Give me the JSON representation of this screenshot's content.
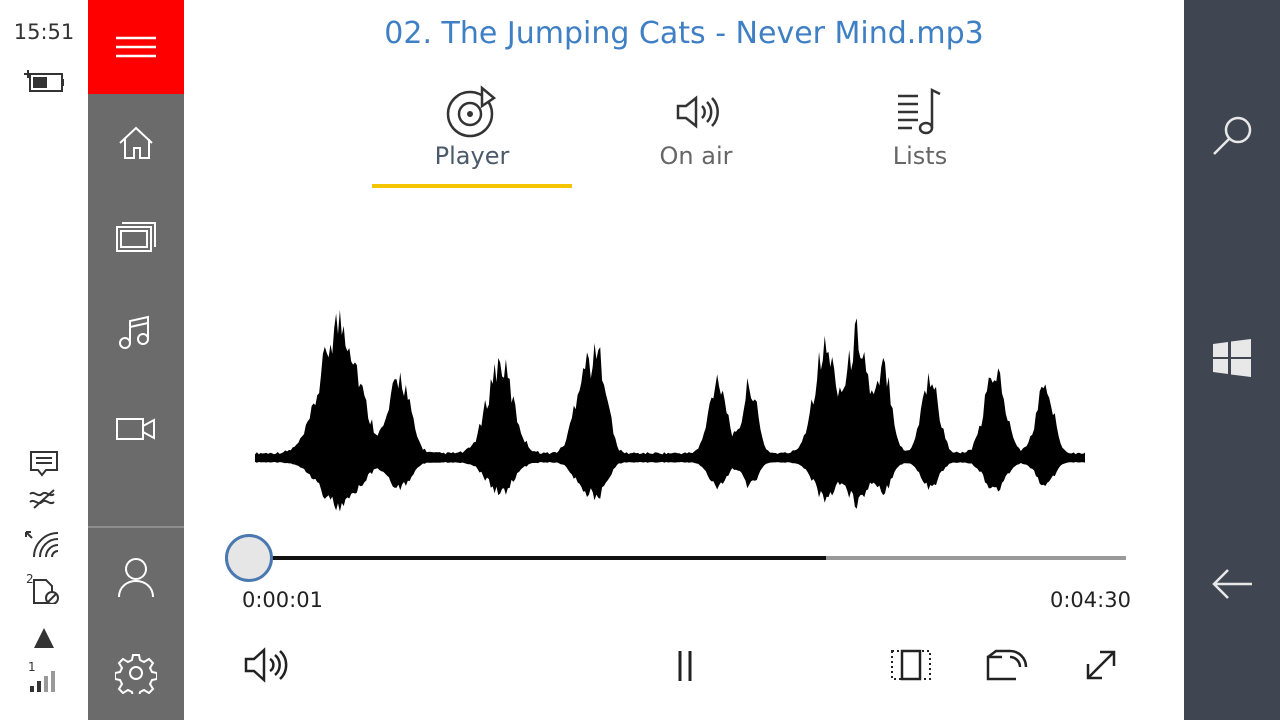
{
  "status_bar": {
    "time": "15:51",
    "signal_sim_1": "1",
    "sim_2_label": "2",
    "icons": [
      "battery-charging-icon",
      "message-icon",
      "quiet-hours-icon",
      "wifi-icon",
      "sim-blocked-icon",
      "data-arrow-icon",
      "signal-bars-icon"
    ]
  },
  "left_nav": {
    "accent_color": "#ff0000",
    "items": [
      "hamburger-menu",
      "home",
      "gallery",
      "music",
      "video",
      "account",
      "settings"
    ]
  },
  "title": "02. The Jumping Cats - Never Mind.mp3",
  "tabs": [
    {
      "label": "Player",
      "icon": "player-disc-icon",
      "active": true
    },
    {
      "label": "On air",
      "icon": "speaker-icon",
      "active": false
    },
    {
      "label": "Lists",
      "icon": "playlist-icon",
      "active": false
    }
  ],
  "colors": {
    "title": "#3f7fc4",
    "active_tab": "#4a5a6a",
    "inactive_tab": "#666666",
    "tab_underline": "#f5c400",
    "right_bar": "#3f4652"
  },
  "playback": {
    "elapsed": "0:00:01",
    "duration": "0:04:30",
    "played_fraction": 0.0037,
    "buffered_fraction": 0.66
  },
  "controls": [
    "volume-icon",
    "pause-icon",
    "aspect-ratio-icon",
    "cast-icon",
    "fullscreen-icon"
  ],
  "right_bar": [
    "search-icon",
    "windows-start-icon",
    "back-arrow-icon"
  ]
}
